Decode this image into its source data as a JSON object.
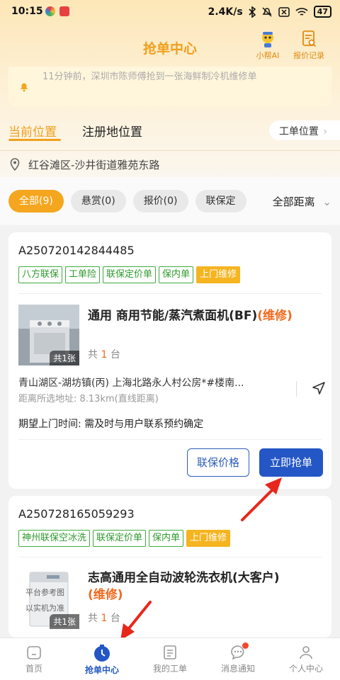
{
  "status_bar": {
    "time": "10:15",
    "network_speed": "2.4K/s",
    "battery": "47"
  },
  "header": {
    "title": "抢单中心",
    "assistant_label": "小帮AI",
    "quote_records_label": "报价记录"
  },
  "notice": {
    "text": "11分钟前，深圳市陈师傅抢到一张海鲜制冷机维修单"
  },
  "location_tabs": {
    "current": "当前位置",
    "registered": "注册地位置",
    "order_location": "工单位置"
  },
  "location": {
    "address": "红谷滩区-沙井街道雅苑东路"
  },
  "filters": {
    "chips": [
      "全部(9)",
      "悬赏(0)",
      "报价(0)",
      "联保定"
    ],
    "active_index": 0,
    "distance": "全部距离"
  },
  "orders": [
    {
      "id": "A250720142844485",
      "tags": [
        "八方联保",
        "工单险",
        "联保定价单",
        "保内单"
      ],
      "highlight_tag": "上门维修",
      "product": "通用 商用节能/蒸汽煮面机(BF)",
      "repair_label": "(维修)",
      "photo_count": "共1张",
      "qty_prefix": "共",
      "qty": "1",
      "qty_unit": "台",
      "address": "青山湖区-湖坊镇(丙) 上海北路永人村公房*#楼南...",
      "distance": "距离所选地址: 8.13km(直线距离)",
      "expected_visit": "期望上门时间: 需及时与用户联系预约确定",
      "price_button": "联保价格",
      "grab_button": "立即抢单"
    },
    {
      "id": "A250728165059293",
      "tags": [
        "神州联保空冰洗",
        "联保定价单",
        "保内单"
      ],
      "highlight_tag": "上门维修",
      "product": "志高通用全自动波轮洗衣机(大客户)",
      "repair_label": "(维修)",
      "photo_count": "共1张",
      "photo_watermark_1": "平台参考图",
      "photo_watermark_2": "以实机为准",
      "qty_prefix": "共",
      "qty": "1",
      "qty_unit": "台"
    }
  ],
  "bottom_nav": [
    {
      "label": "首页"
    },
    {
      "label": "抢单中心"
    },
    {
      "label": "我的工单"
    },
    {
      "label": "消息通知"
    },
    {
      "label": "个人中心"
    }
  ],
  "colors": {
    "accent": "#f0a01e",
    "primary": "#2457c5",
    "tag_green": "#2e9a2e",
    "repair_orange": "#f06a1e"
  }
}
